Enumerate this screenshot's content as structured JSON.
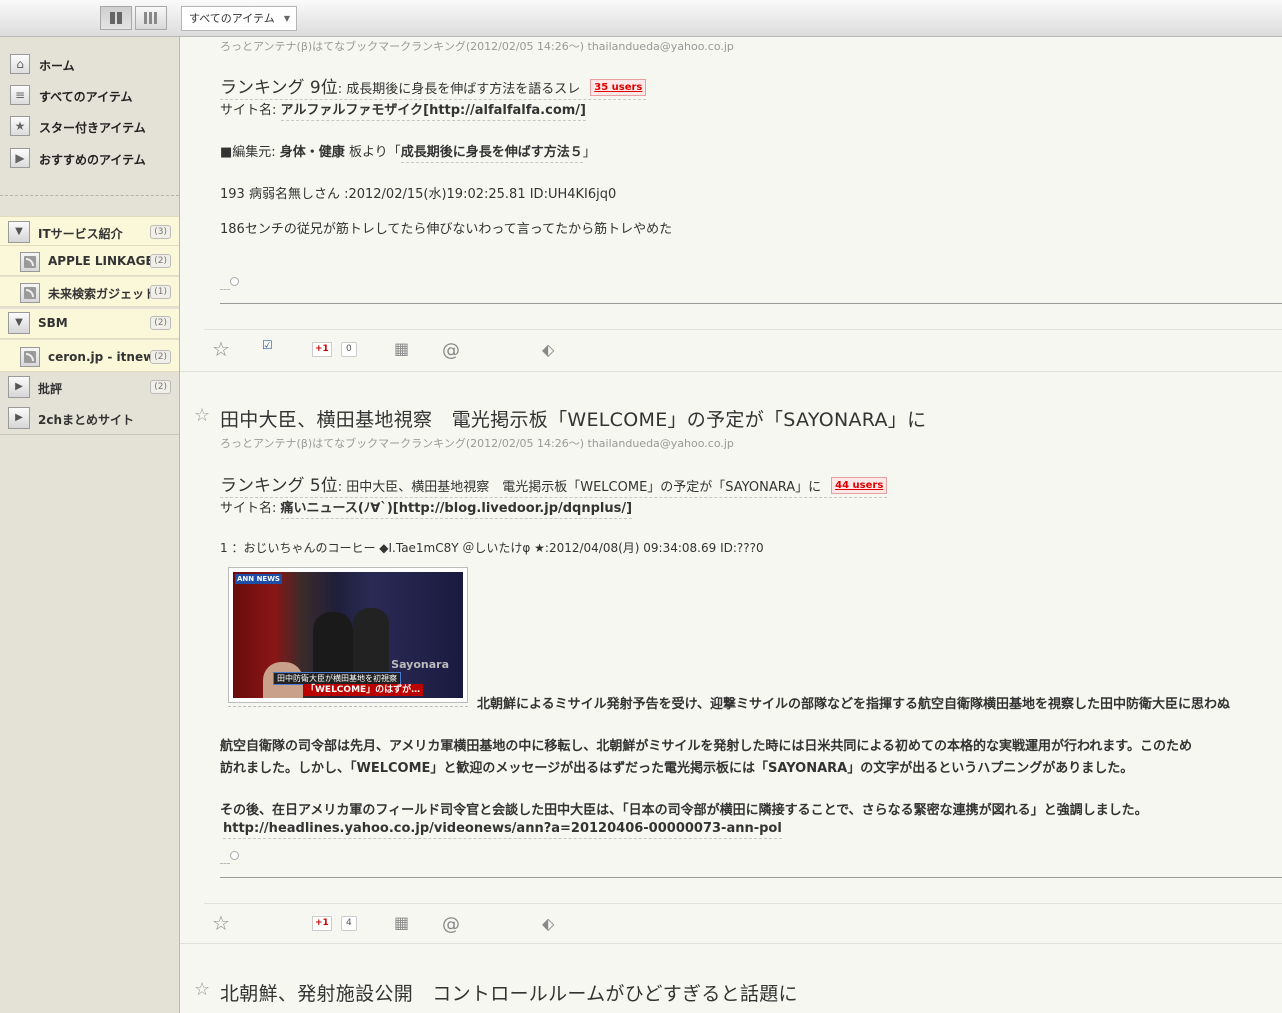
{
  "topbar": {
    "dropdown_label": "すべてのアイテム"
  },
  "sidebar": {
    "nav": [
      {
        "label": "ホーム",
        "icon": "home-icon"
      },
      {
        "label": "すべてのアイテム",
        "icon": "list-icon"
      },
      {
        "label": "スター付きアイテム",
        "icon": "star-icon"
      },
      {
        "label": "おすすめのアイテム",
        "icon": "play-icon"
      }
    ],
    "folders": [
      {
        "label": "ITサービス紹介",
        "count": "(3)",
        "open": true,
        "feeds": [
          {
            "label": "APPLE LINKAGE",
            "count": "(2)"
          },
          {
            "label": "未来検索ガジェット",
            "count": "(1)"
          }
        ]
      },
      {
        "label": "SBM",
        "count": "(2)",
        "open": true,
        "feeds": [
          {
            "label": "ceron.jp - itnews",
            "count": "(2)"
          }
        ]
      },
      {
        "label": "批評",
        "count": "(2)",
        "open": false,
        "feeds": []
      },
      {
        "label": "2chまとめサイト",
        "count": "",
        "open": false,
        "feeds": []
      }
    ]
  },
  "entries": [
    {
      "meta": "ろっとアンテナ(β)はてなブックマークランキング(2012/02/05 14:26〜)  thailandueda@yahoo.co.jp",
      "rank_main": "ランキング 9位",
      "rank_sub": ": 成長期後に身長を伸ばす方法を語るスレ",
      "users": "35 users",
      "site_prefix": "サイト名: ",
      "site_name": "アルファルファモザイク[http://alfalfalfa.com/]",
      "edit_prefix": "■編集元: ",
      "edit_board": "身体・健康",
      "edit_mid": " 板より「",
      "edit_thread": "成長期後に身長を伸ばす方法５",
      "edit_end": "」",
      "post_head": "193 病弱名無しさん :2012/02/15(水)19:02:25.81 ID:UH4KI6jq0",
      "post_body": "186センチの従兄が筋トレしてたら伸びないわって言ってたから筋トレやめた",
      "gplus": "+1",
      "gcount": "0"
    },
    {
      "title": "田中大臣、横田基地視察　電光掲示板「WELCOME」の予定が「SAYONARA」に",
      "meta": "ろっとアンテナ(β)はてなブックマークランキング(2012/02/05 14:26〜)  thailandueda@yahoo.co.jp",
      "rank_main": "ランキング 5位",
      "rank_sub": ": 田中大臣、横田基地視察　電光掲示板「WELCOME」の予定が「SAYONARA」に",
      "users": "44 users",
      "site_prefix": "サイト名: ",
      "site_name": "痛いニュース(ﾉ∀`)[http://blog.livedoor.jp/dqnplus/]",
      "post_head": "1 ：おじいちゃんのコーヒー ◆I.Tae1mC8Y ＠しいたけφ ★:2012/04/08(月) 09:34:08.69 ID:???0",
      "image_label_ann": "ANN NEWS",
      "image_label_sayonara": "Sayonara",
      "image_caption_1": "田中防衛大臣が横田基地を初視察",
      "image_caption_2": "「WELCOME」のはずが…",
      "p1": "北朝鮮によるミサイル発射予告を受け、迎撃ミサイルの部隊などを指揮する航空自衛隊横田基地を視察した田中防衛大臣に思わぬ",
      "p2a": "航空自衛隊の司令部は先月、アメリカ軍横田基地の中に移転し、北朝鮮がミサイルを発射した時には日米共同による初めての本格的な実戦運用が行われます。このため",
      "p2b": "訪れました。しかし、「WELCOME」と歓迎のメッセージが出るはずだった電光掲示板には「SAYONARA」の文字が出るというハプニングがありました。",
      "p3": "その後、在日アメリカ軍のフィールド司令官と会談した田中大臣は、「日本の司令部が横田に隣接することで、さらなる緊密な連携が図れる」と強調しました。",
      "link": "http://headlines.yahoo.co.jp/videonews/ann?a=20120406-00000073-ann-pol",
      "gplus": "+1",
      "gcount": "4"
    },
    {
      "title": "北朝鮮、発射施設公開　コントロールルームがひどすぎると話題に"
    }
  ]
}
